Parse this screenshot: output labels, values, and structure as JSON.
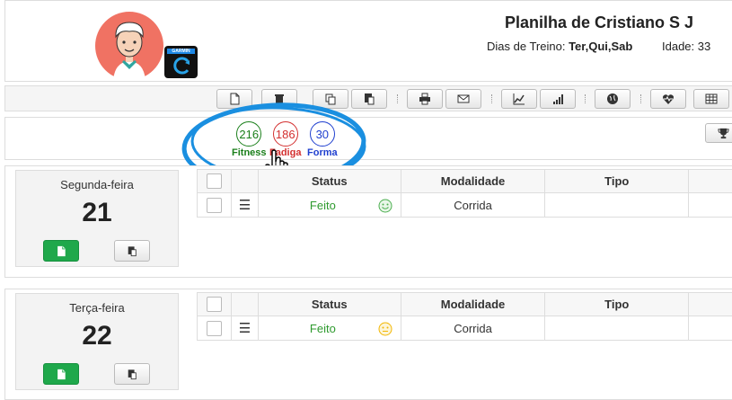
{
  "header": {
    "title": "Planilha de Cristiano S J",
    "training_days_label": "Dias de Treino:",
    "training_days_value": "Ter,Qui,Sab",
    "age_label": "Idade:",
    "age_value": "33",
    "badge_text": "GARMIN"
  },
  "toolbar": {
    "buttons": [
      "new-icon",
      "delete-icon",
      "copy-icon",
      "paste-icon",
      "print-icon",
      "mail-icon",
      "line-chart-icon",
      "bar-chart-icon",
      "globe-icon",
      "heart-rate-icon",
      "table-icon"
    ]
  },
  "stats": {
    "fitness": {
      "value": "216",
      "label": "Fitness",
      "color": "#1a7f1a"
    },
    "fadiga": {
      "value": "186",
      "label": "Fadiga",
      "color": "#d32f2f"
    },
    "forma": {
      "value": "30",
      "label": "Forma",
      "color": "#1f3fcf"
    },
    "highlight_color": "#1a8fe0"
  },
  "table_headers": {
    "status": "Status",
    "modalidade": "Modalidade",
    "tipo": "Tipo"
  },
  "days": [
    {
      "name": "Segunda-feira",
      "number": "21",
      "row": {
        "status": "Feito",
        "mood": "happy",
        "mood_color": "#4caf50",
        "modalidade": "Corrida",
        "tipo": ""
      }
    },
    {
      "name": "Terça-feira",
      "number": "22",
      "row": {
        "status": "Feito",
        "mood": "neutral",
        "mood_color": "#f2b705",
        "modalidade": "Corrida",
        "tipo": ""
      }
    }
  ]
}
